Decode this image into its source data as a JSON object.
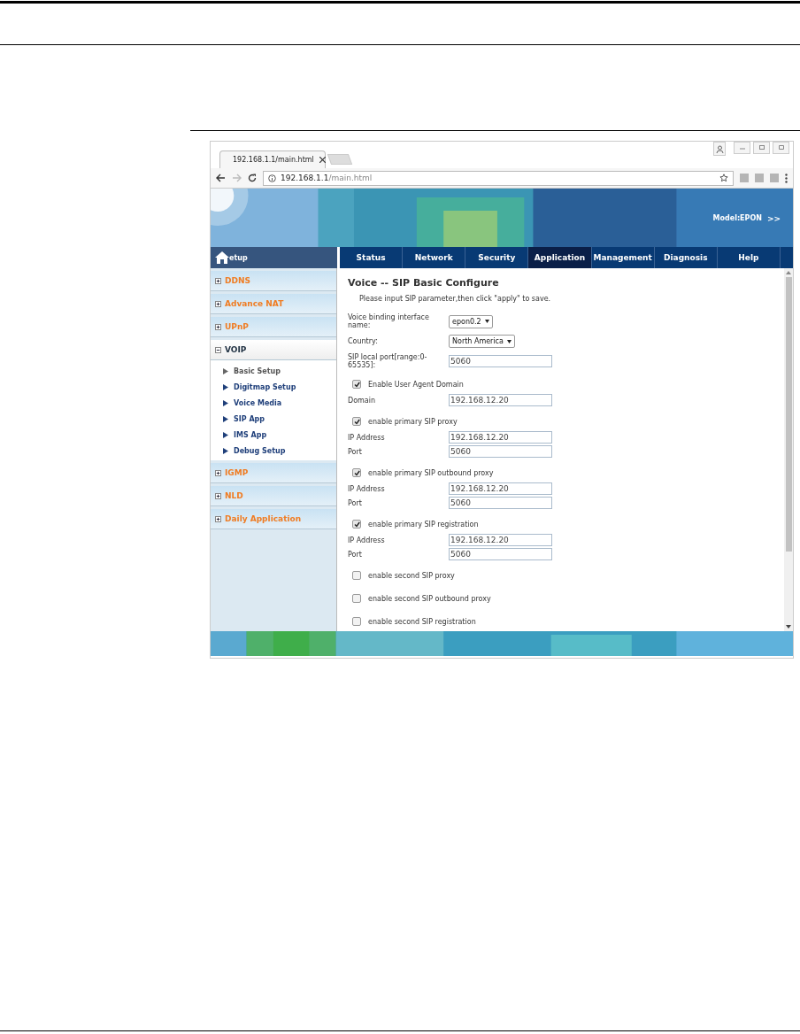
{
  "browser": {
    "tab_title": "192.168.1.1/main.html",
    "url_host": "192.168.1.1",
    "url_path": "/main.html"
  },
  "banner": {
    "model": "Model:EPON",
    "arrows": ">>"
  },
  "sidebar": {
    "header": "etup",
    "items": [
      {
        "label": "DDNS",
        "expanded": false
      },
      {
        "label": "Advance NAT",
        "expanded": false
      },
      {
        "label": "UPnP",
        "expanded": false
      },
      {
        "label": "VOIP",
        "expanded": true,
        "children": [
          {
            "label": "Basic Setup",
            "selected": true
          },
          {
            "label": "Digitmap Setup",
            "selected": false
          },
          {
            "label": "Voice Media",
            "selected": false
          },
          {
            "label": "SIP App",
            "selected": false
          },
          {
            "label": "IMS App",
            "selected": false
          },
          {
            "label": "Debug Setup",
            "selected": false
          }
        ]
      },
      {
        "label": "IGMP",
        "expanded": false
      },
      {
        "label": "NLD",
        "expanded": false
      },
      {
        "label": "Daily Application",
        "expanded": false
      }
    ]
  },
  "nav_tabs": [
    {
      "label": "Status",
      "selected": false
    },
    {
      "label": "Network",
      "selected": false
    },
    {
      "label": "Security",
      "selected": false
    },
    {
      "label": "Application",
      "selected": true
    },
    {
      "label": "Management",
      "selected": false
    },
    {
      "label": "Diagnosis",
      "selected": false
    },
    {
      "label": "Help",
      "selected": false
    }
  ],
  "form": {
    "title": "Voice -- SIP Basic Configure",
    "hint": "Please input SIP parameter,then click \"apply\" to save.",
    "rows": [
      {
        "kind": "select",
        "label": "Voice binding interface name:",
        "value": "epon0.2"
      },
      {
        "kind": "select",
        "label": "Country:",
        "value": "North America"
      },
      {
        "kind": "input",
        "label": "SIP local port[range:0-65535]:",
        "value": "5060"
      },
      {
        "kind": "checkbox",
        "label": "Enable User Agent Domain",
        "checked": true
      },
      {
        "kind": "input",
        "label": "Domain",
        "value": "192.168.12.20"
      },
      {
        "kind": "checkbox",
        "label": "enable primary SIP proxy",
        "checked": true
      },
      {
        "kind": "input",
        "label": "IP Address",
        "value": "192.168.12.20"
      },
      {
        "kind": "input",
        "label": "Port",
        "value": "5060"
      },
      {
        "kind": "checkbox",
        "label": "enable primary SIP outbound proxy",
        "checked": true
      },
      {
        "kind": "input",
        "label": "IP Address",
        "value": "192.168.12.20"
      },
      {
        "kind": "input",
        "label": "Port",
        "value": "5060"
      },
      {
        "kind": "checkbox",
        "label": "enable primary SIP registration",
        "checked": true
      },
      {
        "kind": "input",
        "label": "IP Address",
        "value": "192.168.12.20"
      },
      {
        "kind": "input",
        "label": "Port",
        "value": "5060"
      },
      {
        "kind": "checkbox",
        "label": "enable second SIP proxy",
        "checked": false
      },
      {
        "kind": "checkbox",
        "label": "enable second SIP outbound proxy",
        "checked": false
      },
      {
        "kind": "checkbox",
        "label": "enable second SIP registration",
        "checked": false
      }
    ]
  }
}
